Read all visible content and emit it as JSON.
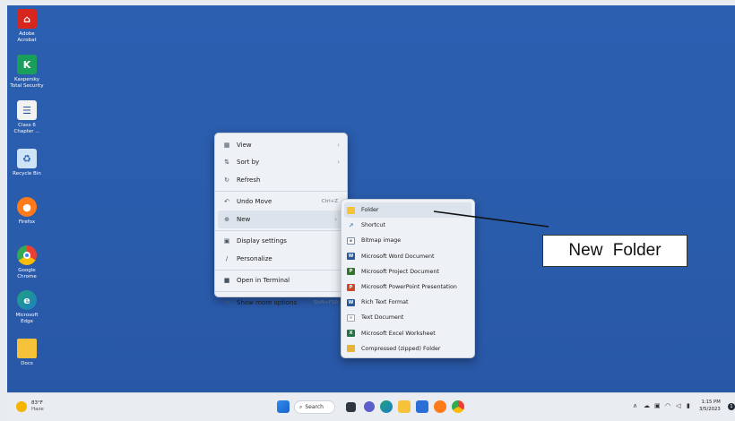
{
  "desktop_icons": [
    {
      "label": "Adobe\nAcrobat",
      "l1": "Adobe",
      "l2": "Acrobat",
      "icon": "acrobat-icon",
      "color": "#d7261e"
    },
    {
      "label": "Kaspersky Total Security",
      "l1": "Kaspersky",
      "l2": "Total Security",
      "icon": "kaspersky-icon",
      "color": "#1a9e5c"
    },
    {
      "label": "Class 6 Chapter ...",
      "l1": "Class 6",
      "l2": "Chapter ...",
      "icon": "document-icon",
      "color": "#f2f2f2"
    },
    {
      "label": "Recycle Bin",
      "l1": "Recycle Bin",
      "l2": "",
      "icon": "recycle-bin-icon",
      "color": "#cfe3f7"
    },
    {
      "label": "Firefox",
      "l1": "Firefox",
      "l2": "",
      "icon": "firefox-icon",
      "color": "#ff7a1a"
    },
    {
      "label": "Google Chrome",
      "l1": "Google",
      "l2": "Chrome",
      "icon": "chrome-icon",
      "color": "#e94235"
    },
    {
      "label": "Microsoft Edge",
      "l1": "Microsoft",
      "l2": "Edge",
      "icon": "edge-icon",
      "color": "#1fa37a"
    },
    {
      "label": "Docs",
      "l1": "Docs",
      "l2": "",
      "icon": "folder-icon",
      "color": "#f5c23a"
    }
  ],
  "context_menu": {
    "view": "View",
    "sort_by": "Sort by",
    "refresh": "Refresh",
    "undo_move": "Undo Move",
    "undo_shortcut": "Ctrl+Z",
    "new": "New",
    "display_settings": "Display settings",
    "personalize": "Personalize",
    "open_in_terminal": "Open in Terminal",
    "show_more_options": "Show more options",
    "show_more_shortcut": "Shift+F10"
  },
  "new_submenu": [
    {
      "label": "Folder",
      "icon": "folder-icon",
      "color": "#f5c23a"
    },
    {
      "label": "Shortcut",
      "icon": "shortcut-icon",
      "color": "#3b82c4"
    },
    {
      "label": "Bitmap image",
      "icon": "bitmap-icon",
      "color": "#7a8aa0"
    },
    {
      "label": "Microsoft Word Document",
      "icon": "word-icon",
      "color": "#2b579a"
    },
    {
      "label": "Microsoft Project Document",
      "icon": "project-icon",
      "color": "#31752f"
    },
    {
      "label": "Microsoft PowerPoint Presentation",
      "icon": "powerpoint-icon",
      "color": "#d24726"
    },
    {
      "label": "Rich Text Format",
      "icon": "rtf-icon",
      "color": "#2b579a"
    },
    {
      "label": "Text Document",
      "icon": "text-doc-icon",
      "color": "#9aa3ad"
    },
    {
      "label": "Microsoft Excel Worksheet",
      "icon": "excel-icon",
      "color": "#217346"
    },
    {
      "label": "Compressed (zipped) Folder",
      "icon": "zip-folder-icon",
      "color": "#e6b43a"
    }
  ],
  "callout": {
    "text": "New Folder"
  },
  "taskbar": {
    "weather_temp": "83°F",
    "weather_desc": "Haze",
    "search": "Search",
    "time": "1:15 PM",
    "date": "3/5/2023",
    "notification_count": "1"
  }
}
